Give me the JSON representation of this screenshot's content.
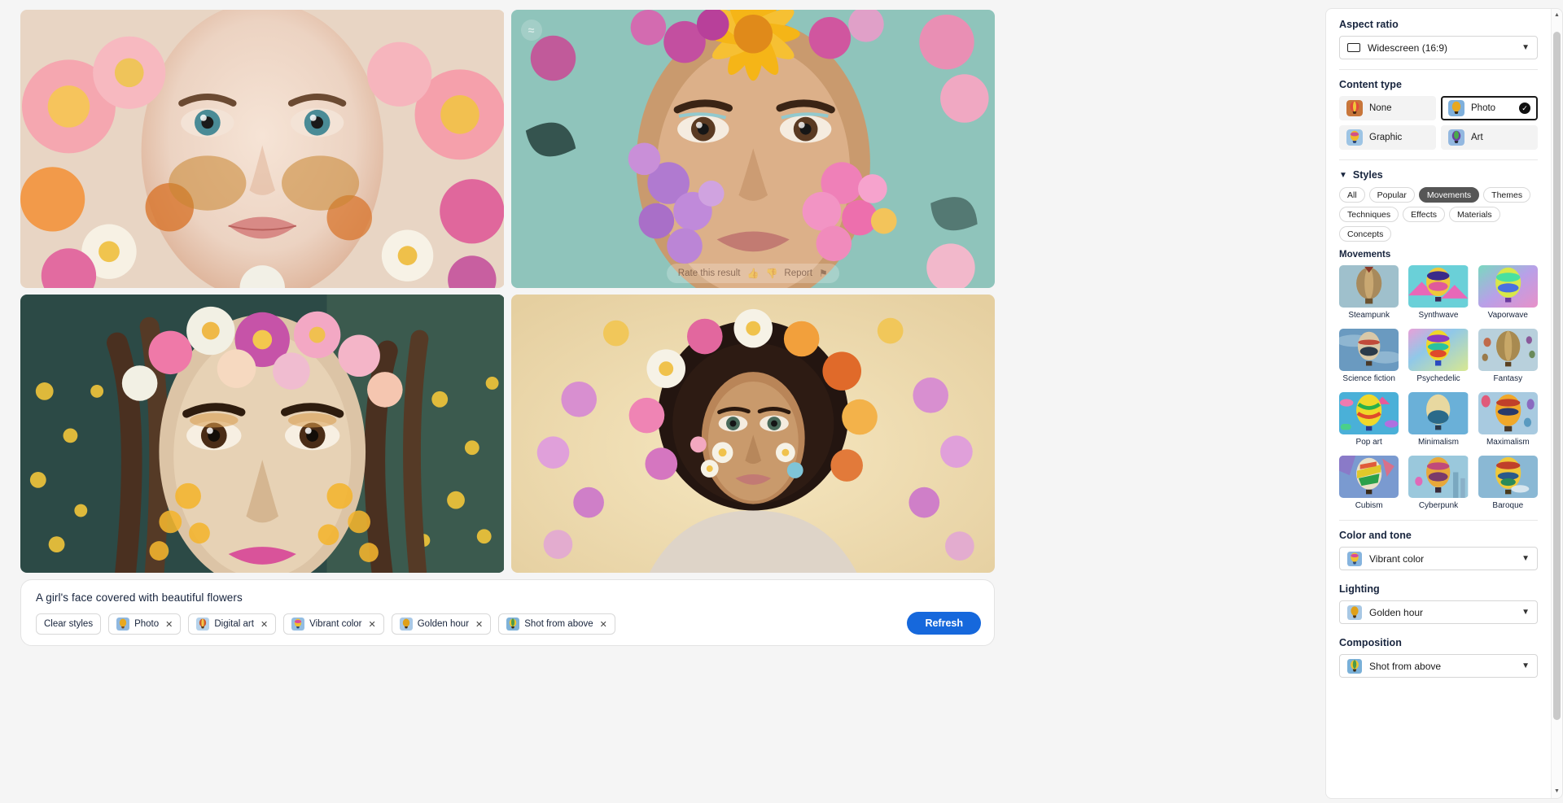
{
  "results": {
    "rate_overlay": {
      "label": "Rate this result",
      "thumbs_up_icon": "thumbs-up-icon",
      "thumbs_down_icon": "thumbs-down-icon",
      "report_label": "Report",
      "flag_icon": "flag-icon"
    },
    "watermark_icon": "content-credentials-icon",
    "images": [
      {
        "alt": "Portrait of a girl's face covered with pink and orange flowers"
      },
      {
        "alt": "Portrait with large yellow sunflower and pink flowers on teal background"
      },
      {
        "alt": "Portrait with pink and white daisies crown on yellow floral background"
      },
      {
        "alt": "Portrait with afro hair surrounded by purple and white flowers"
      }
    ]
  },
  "prompt": {
    "text": "A girl's face covered with beautiful flowers",
    "clear_styles_label": "Clear styles",
    "chips": [
      {
        "label": "Photo",
        "remove_icon": "close-icon"
      },
      {
        "label": "Digital art",
        "remove_icon": "close-icon"
      },
      {
        "label": "Vibrant color",
        "remove_icon": "close-icon"
      },
      {
        "label": "Golden hour",
        "remove_icon": "close-icon"
      },
      {
        "label": "Shot from above",
        "remove_icon": "close-icon"
      }
    ],
    "refresh_label": "Refresh"
  },
  "panel": {
    "aspect_ratio": {
      "title": "Aspect ratio",
      "value": "Widescreen (16:9)",
      "leading_icon": "widescreen-rectangle-icon",
      "chevron_icon": "chevron-down-icon"
    },
    "content_type": {
      "title": "Content type",
      "options": [
        {
          "label": "None",
          "selected": false
        },
        {
          "label": "Photo",
          "selected": true
        },
        {
          "label": "Graphic",
          "selected": false
        },
        {
          "label": "Art",
          "selected": false
        }
      ],
      "check_icon": "check-circle-icon"
    },
    "styles": {
      "title": "Styles",
      "collapse_icon": "chevron-down-icon",
      "filters": [
        {
          "label": "All",
          "active": false
        },
        {
          "label": "Popular",
          "active": false
        },
        {
          "label": "Movements",
          "active": true
        },
        {
          "label": "Themes",
          "active": false
        },
        {
          "label": "Techniques",
          "active": false
        },
        {
          "label": "Effects",
          "active": false
        },
        {
          "label": "Materials",
          "active": false
        },
        {
          "label": "Concepts",
          "active": false
        }
      ],
      "group_title": "Movements",
      "items": [
        {
          "label": "Steampunk"
        },
        {
          "label": "Synthwave"
        },
        {
          "label": "Vaporwave"
        },
        {
          "label": "Science fiction"
        },
        {
          "label": "Psychedelic"
        },
        {
          "label": "Fantasy"
        },
        {
          "label": "Pop art"
        },
        {
          "label": "Minimalism"
        },
        {
          "label": "Maximalism"
        },
        {
          "label": "Cubism"
        },
        {
          "label": "Cyberpunk"
        },
        {
          "label": "Baroque"
        }
      ]
    },
    "color_and_tone": {
      "title": "Color and tone",
      "value": "Vibrant color",
      "chevron_icon": "chevron-down-icon"
    },
    "lighting": {
      "title": "Lighting",
      "value": "Golden hour",
      "chevron_icon": "chevron-down-icon"
    },
    "composition": {
      "title": "Composition",
      "value": "Shot from above",
      "chevron_icon": "chevron-down-icon"
    },
    "scrollbar": {
      "up_icon": "scroll-up-arrow-icon",
      "down_icon": "scroll-down-arrow-icon"
    }
  },
  "colors": {
    "accent": "#1668dc",
    "pill_active_bg": "#565656",
    "text": "#17243d",
    "page_bg": "#f5f5f5"
  }
}
